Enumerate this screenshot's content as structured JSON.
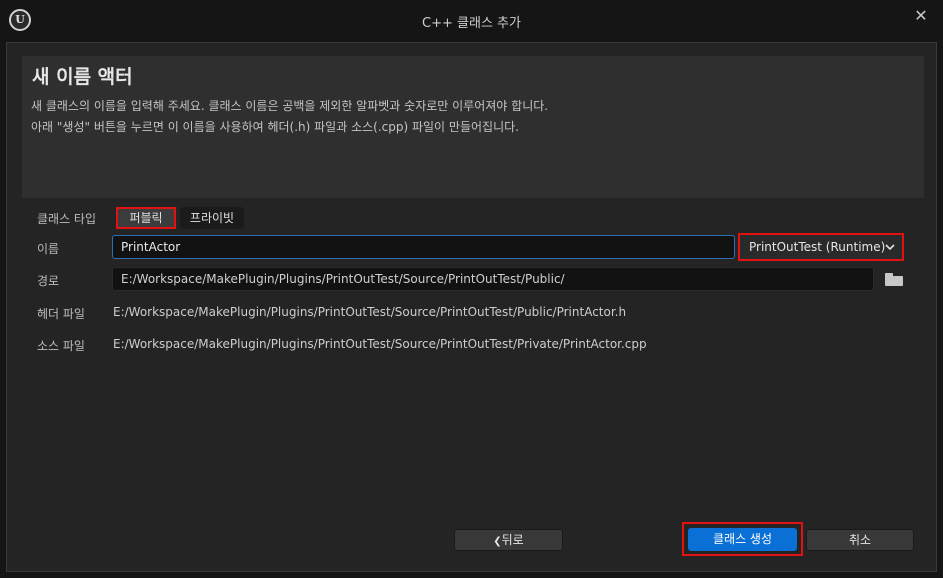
{
  "window": {
    "title": "C++ 클래스 추가",
    "close_glyph": "✕",
    "logo_text": "U"
  },
  "header": {
    "heading": "새 이름 액터",
    "description_line1": "새 클래스의 이름을 입력해 주세요. 클래스 이름은 공백을 제외한 알파벳과 숫자로만 이루어져야 합니다.",
    "description_line2": "아래 \"생성\" 버튼을 누르면 이 이름을 사용하여 헤더(.h) 파일과 소스(.cpp) 파일이 만들어집니다."
  },
  "form": {
    "class_type_label": "클래스 타입",
    "class_type_options": [
      "퍼블릭",
      "프라이빗"
    ],
    "class_type_selected": "퍼블릭",
    "name_label": "이름",
    "name_value": "PrintActor",
    "module_value": "PrintOutTest (Runtime)",
    "path_label": "경로",
    "path_value": "E:/Workspace/MakePlugin/Plugins/PrintOutTest/Source/PrintOutTest/Public/",
    "header_file_label": "헤더 파일",
    "header_file_value": "E:/Workspace/MakePlugin/Plugins/PrintOutTest/Source/PrintOutTest/Public/PrintActor.h",
    "source_file_label": "소스 파일",
    "source_file_value": "E:/Workspace/MakePlugin/Plugins/PrintOutTest/Source/PrintOutTest/Private/PrintActor.cpp"
  },
  "footer": {
    "back_label": "뒤로",
    "back_glyph": "❮",
    "create_label": "클래스 생성",
    "cancel_label": "취소"
  },
  "icons": {
    "module_dropdown": "chevron-down-icon",
    "path_browse": "folder-icon",
    "window_close": "close-icon"
  },
  "colors": {
    "accent_blue": "#0a70d6",
    "highlight_red": "#e21212",
    "focus_border": "#2f6fb0"
  }
}
